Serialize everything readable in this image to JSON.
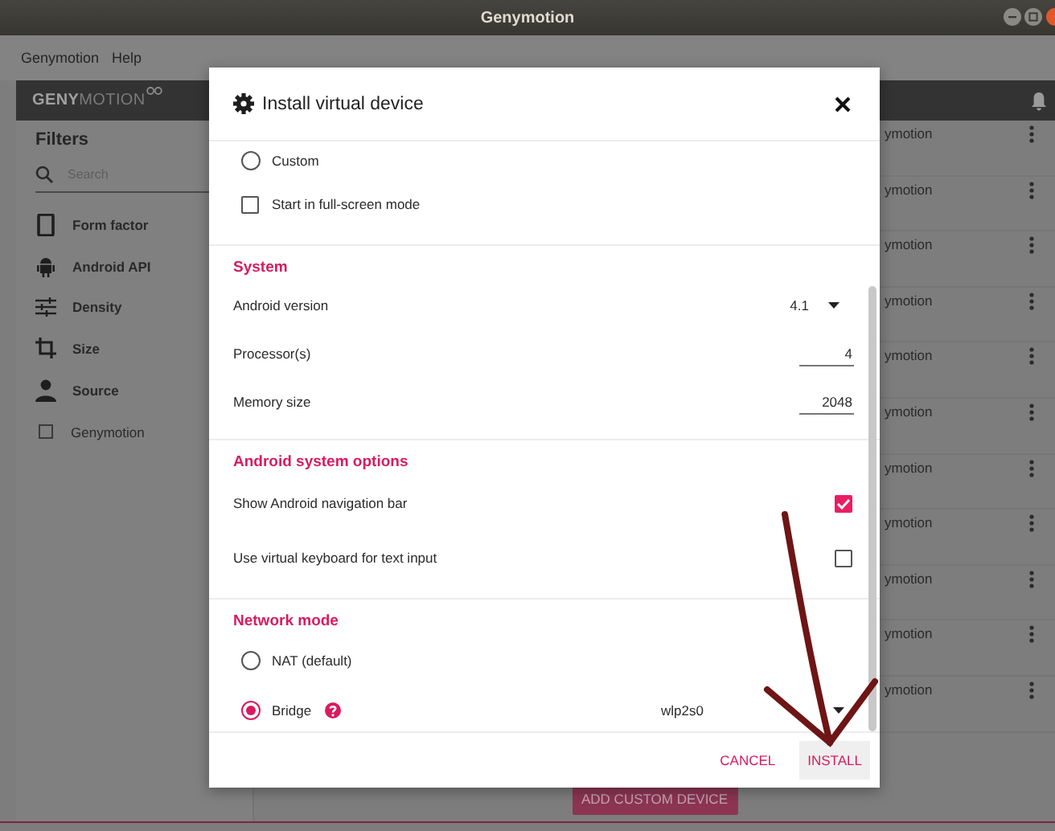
{
  "window": {
    "title": "Genymotion"
  },
  "menu": [
    "Genymotion",
    "Help"
  ],
  "app": {
    "logo_bold": "GENY",
    "logo_light": "MOTION",
    "filters": {
      "title": "Filters",
      "search": {
        "placeholder": "Search"
      },
      "items": [
        {
          "kind": "phone",
          "label": "Form factor"
        },
        {
          "kind": "android",
          "label": "Android API"
        },
        {
          "kind": "sliders",
          "label": "Density"
        },
        {
          "kind": "crop",
          "label": "Size"
        },
        {
          "kind": "person",
          "label": "Source"
        }
      ],
      "checkboxes": [
        {
          "label": "Genymotion",
          "checked": false
        }
      ]
    },
    "device_rows": [
      {
        "text": "ymotion"
      },
      {
        "text": "ymotion"
      },
      {
        "text": "ymotion"
      },
      {
        "text": "ymotion"
      },
      {
        "text": "ymotion"
      },
      {
        "text": "ymotion"
      },
      {
        "text": "ymotion"
      },
      {
        "text": "ymotion"
      },
      {
        "text": "ymotion"
      },
      {
        "text": "ymotion"
      },
      {
        "text": "ymotion"
      }
    ],
    "add_button": "ADD CUSTOM DEVICE"
  },
  "dialog": {
    "title": "Install virtual device",
    "sections": [
      {
        "items": [
          {
            "kind": "radio",
            "label": "Custom",
            "selected": false
          },
          {
            "kind": "checkbox",
            "label": "Start in full-screen mode",
            "checked": false
          }
        ]
      },
      {
        "heading": "System",
        "items": [
          {
            "kind": "dropdown",
            "label": "Android version",
            "value": "4.1"
          },
          {
            "kind": "number",
            "label": "Processor(s)",
            "value": "4"
          },
          {
            "kind": "number",
            "label": "Memory size",
            "value": "2048"
          }
        ]
      },
      {
        "heading": "Android system options",
        "items": [
          {
            "kind": "switch-check",
            "label": "Show Android navigation bar",
            "checked": true
          },
          {
            "kind": "switch-check",
            "label": "Use virtual keyboard for text input",
            "checked": false
          }
        ]
      },
      {
        "heading": "Network mode",
        "items": [
          {
            "kind": "radio",
            "label": "NAT (default)",
            "selected": false
          },
          {
            "kind": "radio",
            "label": "Bridge",
            "selected": true,
            "help": true,
            "value": "wlp2s0"
          }
        ]
      }
    ],
    "buttons": [
      {
        "label": "CANCEL",
        "kind": "flat"
      },
      {
        "label": "INSTALL",
        "kind": "raised"
      }
    ]
  }
}
